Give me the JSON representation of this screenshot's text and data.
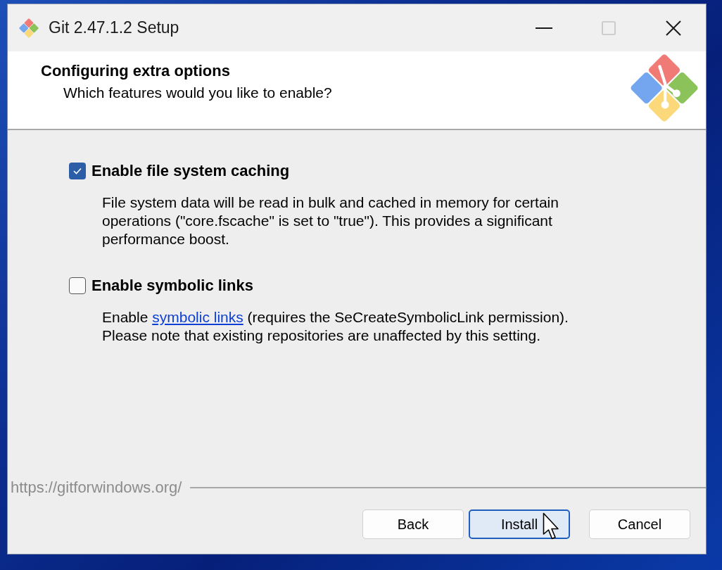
{
  "window": {
    "title": "Git 2.47.1.2 Setup",
    "controls": [
      {
        "kind": "minimize",
        "disabled": false
      },
      {
        "kind": "maximize",
        "disabled": true
      },
      {
        "kind": "close",
        "disabled": false
      }
    ]
  },
  "header": {
    "title": "Configuring extra options",
    "subtitle": "Which features would you like to enable?"
  },
  "options": [
    {
      "label": "Enable file system caching",
      "checked": true,
      "description": [
        {
          "kind": "text",
          "text": "File system data will be read in bulk and cached in memory for certain operations (\"core.fscache\" is set to \"true\"). This provides a significant performance boost."
        }
      ]
    },
    {
      "label": "Enable symbolic links",
      "checked": false,
      "description": [
        {
          "kind": "text",
          "text": "Enable "
        },
        {
          "kind": "link",
          "text": "symbolic links"
        },
        {
          "kind": "text",
          "text": " (requires the SeCreateSymbolicLink permission). Please note that existing repositories are unaffected by this setting."
        }
      ]
    }
  ],
  "footer": {
    "url": "https://gitforwindows.org/"
  },
  "buttons": [
    {
      "label": "Back",
      "focused": false
    },
    {
      "label": "Install",
      "focused": true
    },
    {
      "label": "Cancel",
      "focused": false
    }
  ]
}
